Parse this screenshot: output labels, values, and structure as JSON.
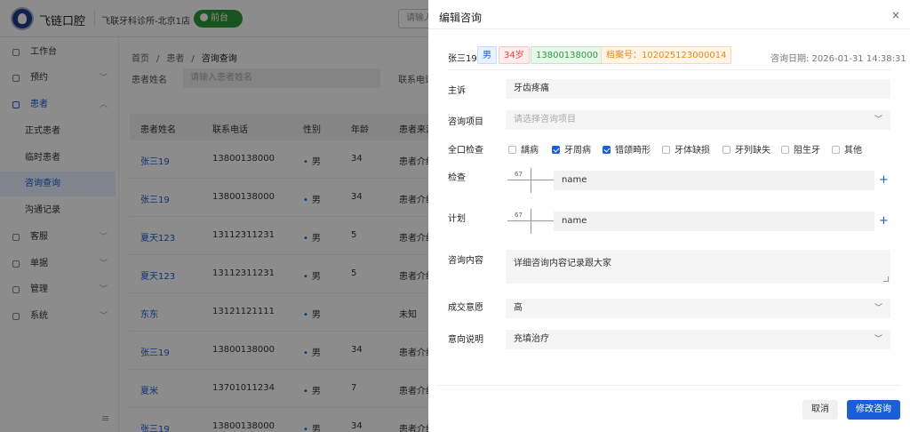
{
  "app": {
    "brand": "飞链口腔",
    "clinic": "飞联牙科诊所-北京1店",
    "front_desk": "前台",
    "top_search_placeholder": "请输入"
  },
  "sidebar": {
    "items": [
      {
        "label": "工作台",
        "icon": "dashboard-icon"
      },
      {
        "label": "预约",
        "icon": "calendar-icon"
      },
      {
        "label": "患者",
        "icon": "user-icon"
      },
      {
        "label": "正式患者"
      },
      {
        "label": "临时患者"
      },
      {
        "label": "咨询查询"
      },
      {
        "label": "沟通记录"
      },
      {
        "label": "客服",
        "icon": "headset-icon"
      },
      {
        "label": "单据",
        "icon": "document-icon"
      },
      {
        "label": "管理",
        "icon": "grid-icon"
      },
      {
        "label": "系统",
        "icon": "gear-icon"
      }
    ]
  },
  "breadcrumb": [
    "首页",
    "/",
    "患者",
    "/",
    "咨询查询"
  ],
  "filter": {
    "name_label": "患者姓名",
    "name_placeholder": "请输入患者姓名",
    "phone_label": "联系电话"
  },
  "table": {
    "headers": [
      "患者姓名",
      "联系电话",
      "性别",
      "年龄",
      "患者来源"
    ],
    "rows": [
      [
        "张三19",
        "13800138000",
        "男",
        "34",
        "患者介绍"
      ],
      [
        "张三19",
        "13800138000",
        "男",
        "34",
        "患者介绍"
      ],
      [
        "夏天123",
        "13112311231",
        "男",
        "5",
        "患者介绍"
      ],
      [
        "夏天123",
        "13112311231",
        "男",
        "5",
        "患者介绍"
      ],
      [
        "东东",
        "13121121111",
        "男",
        "",
        "未知"
      ],
      [
        "张三19",
        "13800138000",
        "男",
        "34",
        "患者介绍"
      ],
      [
        "夏米",
        "13701011234",
        "男",
        "7",
        "患者介绍"
      ],
      [
        "张三19",
        "13800138000",
        "男",
        "34",
        "患者介绍"
      ]
    ]
  },
  "drawer": {
    "title": "编辑咨询",
    "close": "×",
    "patient": {
      "name": "张三19",
      "sex": "男",
      "age": "34岁",
      "phone": "13800138000",
      "file_no": "档案号：102025123000014",
      "consult_date": "咨询日期: 2026-01-31 14:38:31"
    },
    "fields": {
      "complaint_label": "主诉",
      "complaint_value": "牙齿疼痛",
      "project_label": "咨询项目",
      "project_placeholder": "请选择咨询项目",
      "exam_all_label": "全口检查",
      "checks": [
        {
          "label": "龋病",
          "checked": false
        },
        {
          "label": "牙周病",
          "checked": true
        },
        {
          "label": "错颌畸形",
          "checked": true
        },
        {
          "label": "牙体缺损",
          "checked": false
        },
        {
          "label": "牙列缺失",
          "checked": false
        },
        {
          "label": "阻生牙",
          "checked": false
        },
        {
          "label": "其他",
          "checked": false
        }
      ],
      "exam_label": "检查",
      "exam_tooth": "67",
      "exam_value": "name",
      "plan_label": "计划",
      "plan_tooth": "67",
      "plan_value": "name",
      "content_label": "咨询内容",
      "content_value": "详细咨询内容记录跟大家",
      "intent_label": "成交意愿",
      "intent_value": "高",
      "intent_note_label": "意向说明",
      "intent_note_value": "充填治疗"
    },
    "buttons": {
      "cancel": "取消",
      "submit": "修改咨询"
    }
  },
  "colors": {
    "primary": "#1a5fd6",
    "success": "#2e9a3a",
    "danger": "#e0463a",
    "warning": "#e58a1d"
  }
}
